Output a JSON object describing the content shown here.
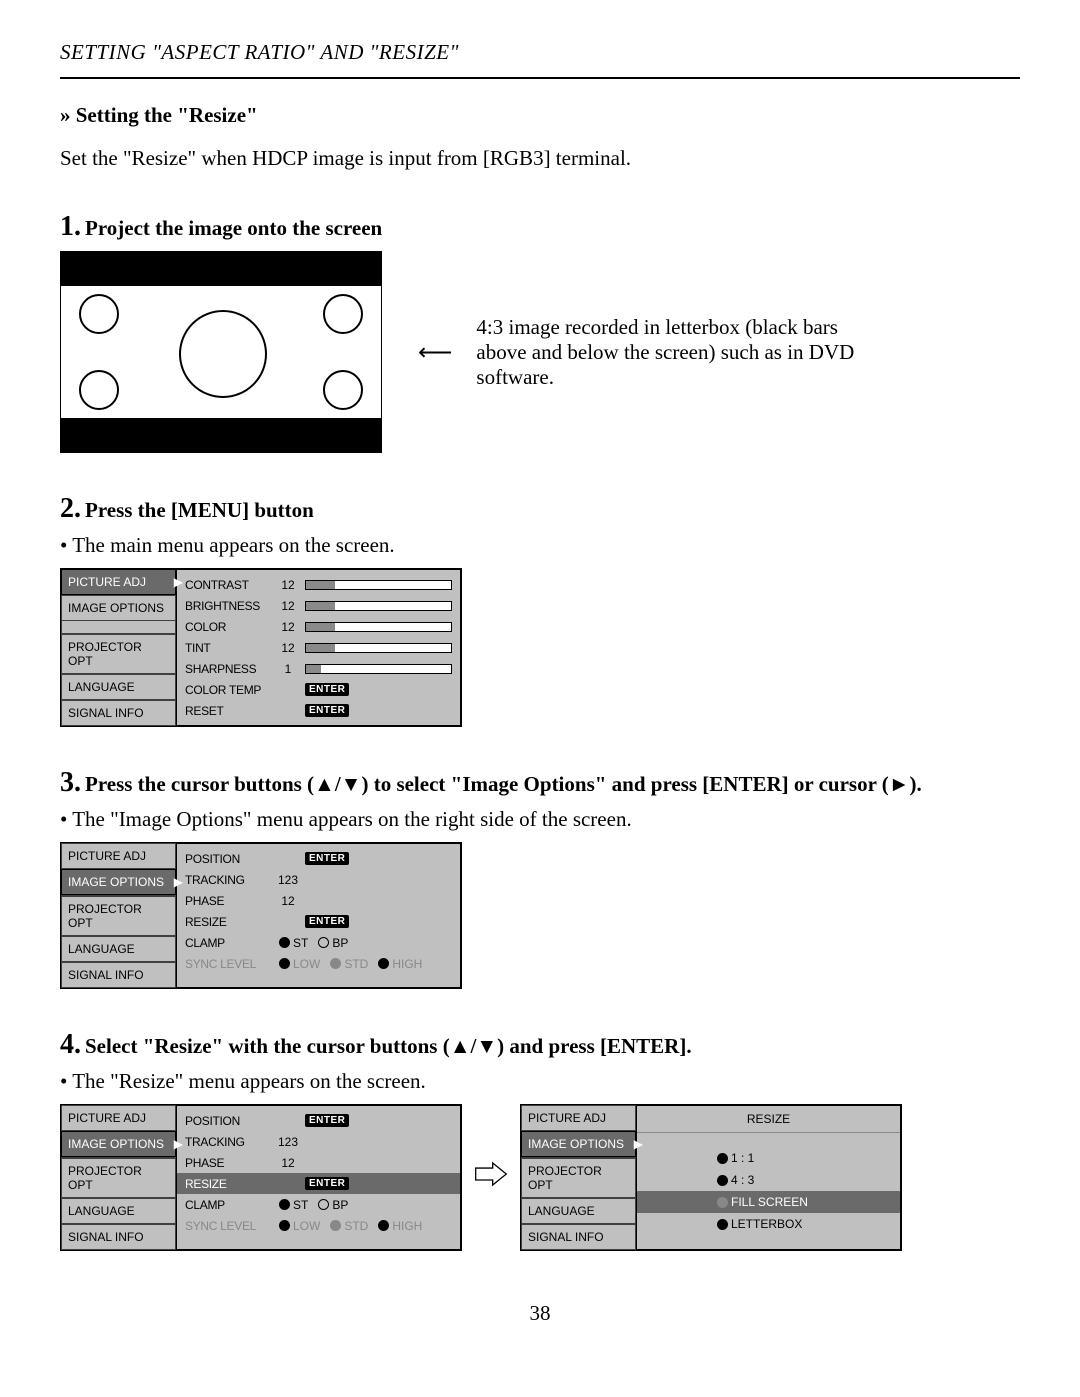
{
  "header": "SETTING \"ASPECT RATIO\" AND \"RESIZE\"",
  "subheading": "» Setting the \"Resize\"",
  "intro": "Set the \"Resize\" when HDCP image is input from [RGB3] terminal.",
  "step1": {
    "num": "1.",
    "title": "Project the image onto the screen",
    "note": "4:3 image recorded in letterbox (black bars above and below the screen) such as in DVD software."
  },
  "step2": {
    "num": "2.",
    "title": "Press the [MENU] button",
    "bullet": "• The main menu appears on the screen."
  },
  "step3": {
    "num": "3.",
    "title": "Press the cursor buttons (▲/▼) to select \"Image Options\" and press [ENTER] or cursor (►).",
    "bullet": "• The \"Image Options\" menu appears on the right side of the screen."
  },
  "step4": {
    "num": "4.",
    "title": "Select \"Resize\" with the cursor buttons (▲/▼) and press [ENTER].",
    "bullet": "• The \"Resize\" menu appears on the screen."
  },
  "sidebar": {
    "picture_adj": "PICTURE ADJ",
    "image_options": "IMAGE OPTIONS",
    "projector_opt": "PROJECTOR OPT",
    "language": "LANGUAGE",
    "signal_info": "SIGNAL INFO"
  },
  "menu1": {
    "rows": [
      {
        "label": "CONTRAST",
        "val": "12",
        "bar": 20
      },
      {
        "label": "BRIGHTNESS",
        "val": "12",
        "bar": 20
      },
      {
        "label": "COLOR",
        "val": "12",
        "bar": 20
      },
      {
        "label": "TINT",
        "val": "12",
        "bar": 20
      },
      {
        "label": "SHARPNESS",
        "val": "1",
        "bar": 10
      },
      {
        "label": "COLOR TEMP",
        "enter": true
      },
      {
        "label": "RESET",
        "enter": true
      }
    ]
  },
  "menu2": {
    "rows": [
      {
        "label": "POSITION",
        "enter": true
      },
      {
        "label": "TRACKING",
        "val": "123"
      },
      {
        "label": "PHASE",
        "val": "12"
      },
      {
        "label": "RESIZE",
        "enter": true
      },
      {
        "label": "CLAMP",
        "radios": [
          {
            "t": "ST",
            "f": true
          },
          {
            "t": "BP",
            "f": false
          }
        ]
      },
      {
        "label": "SYNC LEVEL",
        "dim": true,
        "radios": [
          {
            "t": "LOW",
            "f": true
          },
          {
            "t": "STD",
            "g": true
          },
          {
            "t": "HIGH",
            "f": true
          }
        ]
      }
    ]
  },
  "menu3": {
    "rows": [
      {
        "label": "POSITION",
        "enter": true
      },
      {
        "label": "TRACKING",
        "val": "123"
      },
      {
        "label": "PHASE",
        "val": "12"
      },
      {
        "label": "RESIZE",
        "enter": true,
        "hl": true
      },
      {
        "label": "CLAMP",
        "radios": [
          {
            "t": "ST",
            "f": true
          },
          {
            "t": "BP",
            "f": false
          }
        ]
      },
      {
        "label": "SYNC LEVEL",
        "dim": true,
        "radios": [
          {
            "t": "LOW",
            "f": true
          },
          {
            "t": "STD",
            "g": true
          },
          {
            "t": "HIGH",
            "f": true
          }
        ]
      }
    ]
  },
  "resize_menu": {
    "title": "RESIZE",
    "opts": [
      {
        "t": "1 : 1",
        "f": true
      },
      {
        "t": "4 : 3",
        "f": true
      },
      {
        "t": "FILL SCREEN",
        "f": false,
        "hl": true
      },
      {
        "t": "LETTERBOX",
        "f": true
      }
    ]
  },
  "enter_label": "ENTER",
  "pagenum": "38"
}
